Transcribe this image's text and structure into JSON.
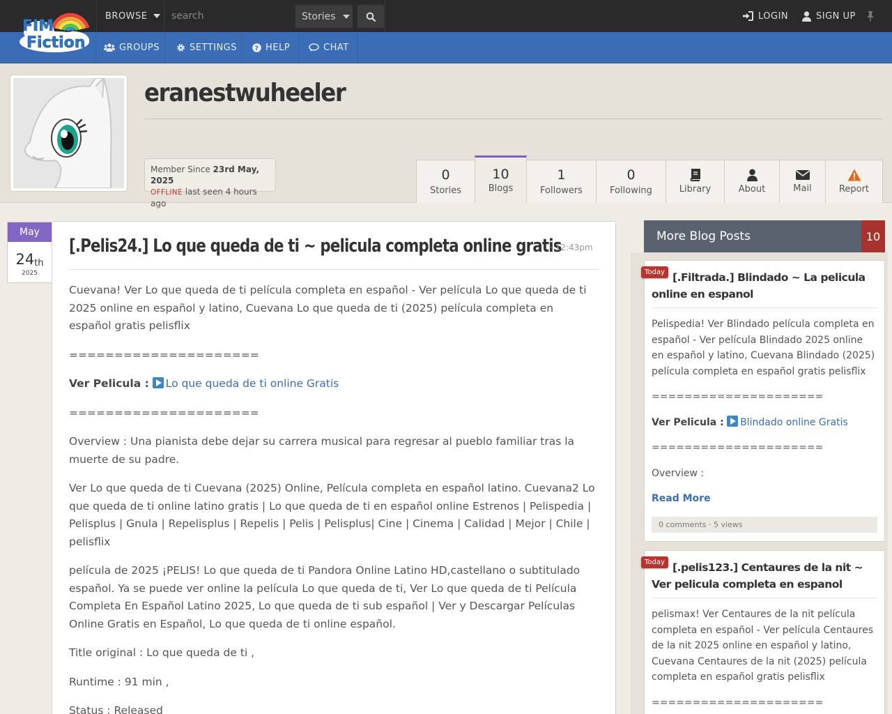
{
  "topbar": {
    "logo_alt": "FIM Fiction",
    "browse_label": "BROWSE",
    "search_placeholder": "search",
    "search_type": "Stories",
    "login_label": "LOGIN",
    "signup_label": "SIGN UP"
  },
  "nav": {
    "groups": "GROUPS",
    "settings": "SETTINGS",
    "help": "HELP",
    "chat": "CHAT"
  },
  "profile": {
    "username": "eranestwuheeler",
    "member_since_label": "Member Since",
    "member_since_date": "23rd May, 2025",
    "status": "OFFLINE",
    "last_seen": "last seen 4 hours ago",
    "tabs": [
      {
        "num": "0",
        "label": "Stories"
      },
      {
        "num": "10",
        "label": "Blogs"
      },
      {
        "num": "1",
        "label": "Followers"
      },
      {
        "num": "0",
        "label": "Following"
      },
      {
        "num": "",
        "label": "Library"
      },
      {
        "num": "",
        "label": "About"
      },
      {
        "num": "",
        "label": "Mail"
      },
      {
        "num": "",
        "label": "Report"
      }
    ]
  },
  "post": {
    "month": "May",
    "day": "24",
    "day_suffix": "th",
    "year": "2025",
    "title": "[.Pelis24.] Lo que queda de ti ~ pelicula completa online gratis",
    "time": "· 12:43pm",
    "p1": "Cuevana! Ver Lo que queda de ti película completa en español - Ver película Lo que queda de ti 2025 online en español y latino, Cuevana Lo que queda de ti (2025) película completa en español gratis pelisflix",
    "sep": "=====================",
    "ver_label": "Ver Pelicula :",
    "ver_link": "Lo que queda de ti online Gratis",
    "overview": "Overview : Una pianista debe dejar su carrera musical para regresar al pueblo familiar tras la muerte de su padre.",
    "p2": "Ver Lo que queda de ti Cuevana (2025) Online, Película completa en español latino. Cuevana2 Lo que queda de ti online latino gratis | Lo que queda de ti en español online Estrenos | Pelispedia | Pelisplus | Gnula | Repelisplus | Repelis | Pelis | Pelisplus| Cine | Cinema | Calidad | Mejor | Chile | pelisflix",
    "p3": "película de 2025 ¡PELIS! Lo que queda de ti Pandora Online Latino HD,castellano o subtitulado español. Ya se puede ver online la película Lo que queda de ti, Ver Lo que queda de ti Película Completa En Español Latino 2025, Lo que queda de ti sub español | Ver y Descargar Películas Online Gratis en Español, Lo que queda de ti online español.",
    "title_original": "Title original : Lo que queda de ti ,",
    "runtime": "Runtime : 91 min ,",
    "status": "Status : Released"
  },
  "sidebar": {
    "heading": "More Blog Posts",
    "count": "10",
    "cards": [
      {
        "badge": "Today",
        "title": "[.Filtrada.] Blindado ~ La pelicula online en espanol",
        "body": "Pelispedia! Ver Blindado película completa en español - Ver película Blindado 2025 online en español y latino, Cuevana Blindado (2025) película completa en español gratis pelisflix",
        "sep": "=====================",
        "ver_label": "Ver Pelicula :",
        "ver_link": "Blindado online Gratis",
        "sep2": "=====================",
        "overview": "Overview :",
        "read_more": "Read More",
        "meta": "0 comments · 5 views"
      },
      {
        "badge": "Today",
        "title": "[.pelis123.] Centaures de la nit ~ Ver pelicula completa en espanol",
        "body": "pelismax! Ver Centaures de la nit película completa en español - Ver película Centaures de la nit 2025 online en español y latino, Cuevana Centaures de la nit (2025) película completa en español gratis pelisflix",
        "sep": "====================="
      }
    ]
  },
  "colors": {
    "topbar": "#2a2a2b",
    "navbar": "#3a6db6",
    "accent_purple": "#8466c4",
    "badge_red": "#b8342d",
    "link": "#3a6db6"
  }
}
